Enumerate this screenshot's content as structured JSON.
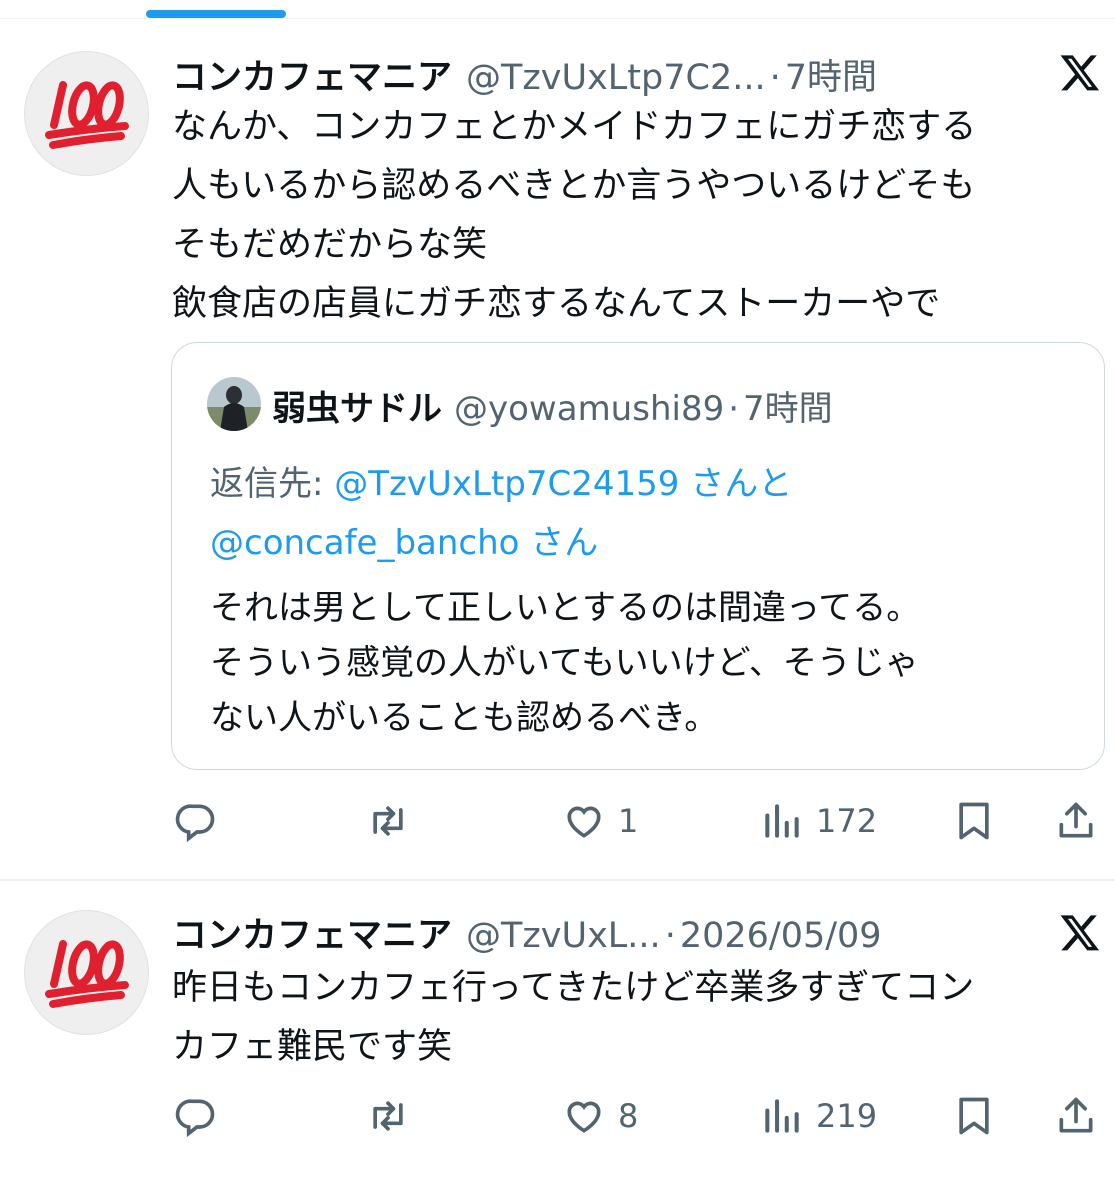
{
  "tweets": [
    {
      "author_name": "コンカフェマニア",
      "handle": "@TzvUxLtp7C2...",
      "separator": "·",
      "time": "7時間",
      "avatar_icon": "hundred-points-emoji",
      "text": "なんか、コンカフェとかメイドカフェにガチ恋する\n人もいるから認めるべきとか言うやついるけどそも\nそもだめだからな笑\n飲食店の店員にガチ恋するなんてストーカーやで",
      "quote": {
        "author_name": "弱虫サドル",
        "handle": "@yowamushi89",
        "separator": "·",
        "time": "7時間",
        "reply_prefix": "返信先: ",
        "reply_mention_1": "@TzvUxLtp7C24159",
        "reply_mid": " さんと",
        "reply_mention_2": "@concafe_bancho",
        "reply_suffix": " さん",
        "text": "それは男として正しいとするのは間違ってる。\nそういう感覚の人がいてもいいけど、そうじゃ\nない人がいることも認めるべき。"
      },
      "metrics": {
        "replies": "",
        "retweets": "",
        "likes": "1",
        "views": "172"
      }
    },
    {
      "author_name": "コンカフェマニア",
      "handle": "@TzvUxL...",
      "separator": "·",
      "time": "2026/05/09",
      "avatar_icon": "hundred-points-emoji",
      "text": "昨日もコンカフェ行ってきたけど卒業多すぎてコン\nカフェ難民です笑",
      "metrics": {
        "replies": "",
        "retweets": "",
        "likes": "8",
        "views": "219"
      }
    }
  ],
  "colors": {
    "accent": "#1d9bf0",
    "text_primary": "#0f1419",
    "text_secondary": "#536471",
    "border": "#cfd9de",
    "emoji_red": "#e0202f"
  }
}
